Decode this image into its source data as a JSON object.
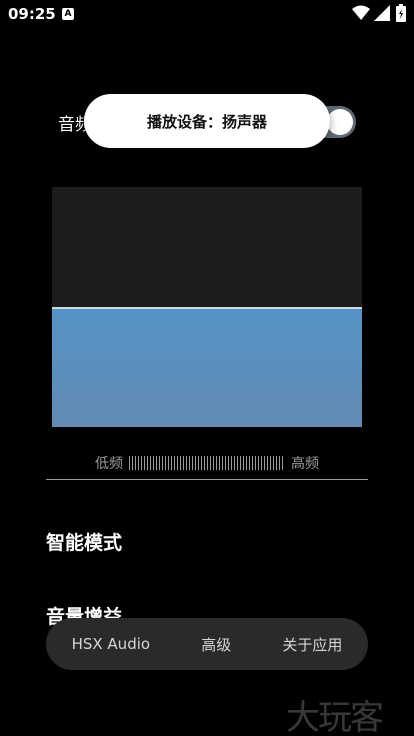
{
  "status_bar": {
    "time": "09:25",
    "notification_glyph": "A"
  },
  "audio_row": {
    "label": "音频",
    "toggle_on": true
  },
  "toast": {
    "text": "播放设备：扬声器"
  },
  "visualizer": {
    "level": 0.5
  },
  "frequency": {
    "low_label": "低频",
    "high_label": "高频"
  },
  "sections": {
    "smart_mode": "智能模式",
    "volume_gain": "音量增益"
  },
  "bottom_nav": {
    "items": [
      "HSX Audio",
      "高级",
      "关于应用"
    ]
  },
  "watermark": "大玩客",
  "colors": {
    "background": "#000000",
    "visualizer_bg": "#1c1c1c",
    "visualizer_fill": "#5592c6",
    "toggle_track": "#5f6b74",
    "nav_bg": "#2a2a2a"
  }
}
